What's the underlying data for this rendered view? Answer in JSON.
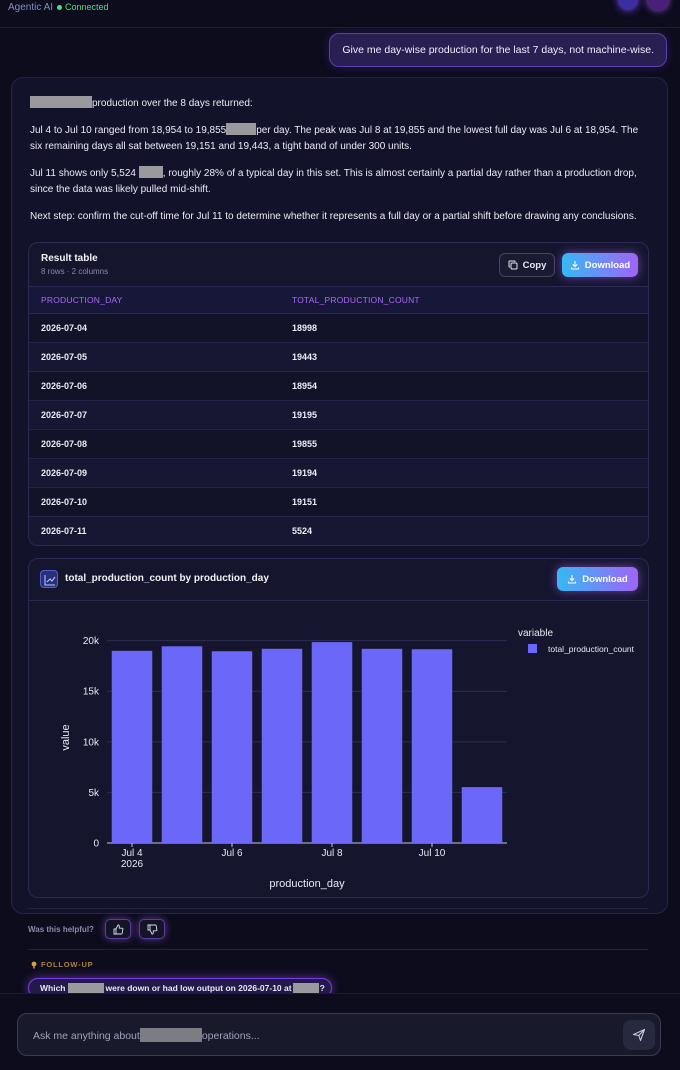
{
  "app": {
    "brand": "Agentic AI",
    "status": "Connected"
  },
  "user_message": "Give me day-wise production for the last 7 days, not machine-wise.",
  "response": {
    "intro": "production over the 8 days returned:",
    "p1_a": "Jul 4 to Jul 10 ranged from 18,954 to 19,855",
    "p1_b": "per day. The peak was Jul 8 at 19,855 and the lowest full day was Jul 6 at 18,954. The six remaining days all sat between 19,151 and 19,443, a tight band of under 300 units.",
    "p2_a": "Jul 11 shows only 5,524",
    "p2_b": ", roughly 28% of a typical day in this set. This is almost certainly a partial day rather than a production drop, since the data was likely pulled mid-shift.",
    "p3": "Next step: confirm the cut-off time for Jul 11 to determine whether it represents a full day or a partial shift before drawing any conclusions."
  },
  "result_table": {
    "title": "Result table",
    "subtitle": "8 rows · 2 columns",
    "copy_label": "Copy",
    "download_label": "Download",
    "columns": [
      "PRODUCTION_DAY",
      "TOTAL_PRODUCTION_COUNT"
    ],
    "rows": [
      [
        "2026-07-04",
        "18998"
      ],
      [
        "2026-07-05",
        "19443"
      ],
      [
        "2026-07-06",
        "18954"
      ],
      [
        "2026-07-07",
        "19195"
      ],
      [
        "2026-07-08",
        "19855"
      ],
      [
        "2026-07-09",
        "19194"
      ],
      [
        "2026-07-10",
        "19151"
      ],
      [
        "2026-07-11",
        "5524"
      ]
    ]
  },
  "chart_card": {
    "title": "total_production_count by production_day",
    "download_label": "Download"
  },
  "chart_data": {
    "type": "bar",
    "title": "total_production_count by production_day",
    "xlabel": "production_day",
    "ylabel": "value",
    "x": [
      "2026-07-04",
      "2026-07-05",
      "2026-07-06",
      "2026-07-07",
      "2026-07-08",
      "2026-07-09",
      "2026-07-10",
      "2026-07-11"
    ],
    "x_tick_labels": [
      {
        "x": "2026-07-04",
        "text": "Jul 4",
        "sub": "2026"
      },
      {
        "x": "2026-07-06",
        "text": "Jul 6",
        "sub": ""
      },
      {
        "x": "2026-07-08",
        "text": "Jul 8",
        "sub": ""
      },
      {
        "x": "2026-07-10",
        "text": "Jul 10",
        "sub": ""
      }
    ],
    "series": [
      {
        "name": "total_production_count",
        "values": [
          18998,
          19443,
          18954,
          19195,
          19855,
          19194,
          19151,
          5524
        ],
        "color": "#6b67f8"
      }
    ],
    "y_ticks": [
      0,
      5000,
      10000,
      15000,
      20000
    ],
    "y_tick_labels": [
      "0",
      "5k",
      "10k",
      "15k",
      "20k"
    ],
    "ylim": [
      0,
      20855
    ],
    "legend_title": "variable",
    "legend_position": "right",
    "grid": true
  },
  "feedback": {
    "prompt": "Was this helpful?"
  },
  "followup": {
    "label": "FOLLOW-UP",
    "chip_a": "Which",
    "chip_b": "were down or had low output on 2026-07-10 at",
    "chip_c": "?"
  },
  "composer": {
    "placeholder_a": "Ask me anything about",
    "placeholder_b": "operations..."
  },
  "colors": {
    "accent": "#a855f7",
    "bar": "#6b67f8",
    "connected": "#4ade80"
  }
}
